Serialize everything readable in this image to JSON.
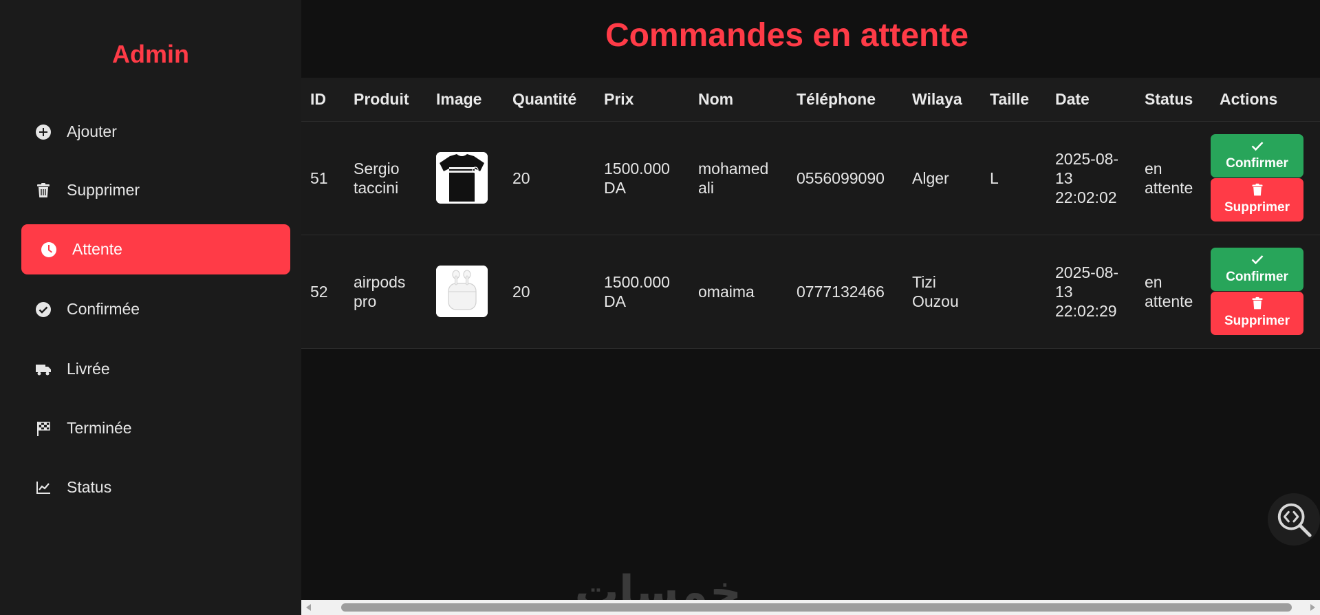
{
  "sidebar": {
    "brand": "Admin",
    "items": [
      {
        "label": "Ajouter",
        "icon": "plus-circle-icon"
      },
      {
        "label": "Supprimer",
        "icon": "trash-icon"
      },
      {
        "label": "Attente",
        "icon": "clock-icon",
        "active": true
      },
      {
        "label": "Confirmée",
        "icon": "check-circle-icon"
      },
      {
        "label": "Livrée",
        "icon": "truck-icon"
      },
      {
        "label": "Terminée",
        "icon": "checkered-flag-icon"
      },
      {
        "label": "Status",
        "icon": "line-chart-icon"
      }
    ]
  },
  "main": {
    "title": "Commandes en attente",
    "columns": [
      "ID",
      "Produit",
      "Image",
      "Quantité",
      "Prix",
      "Nom",
      "Téléphone",
      "Wilaya",
      "Taille",
      "Date",
      "Status",
      "Actions"
    ],
    "rows": [
      {
        "id": "51",
        "produit": "Sergio taccini",
        "image": "black t-shirt",
        "quantite": "20",
        "prix": "1500.000 DA",
        "nom": "mohamed ali",
        "telephone": "0556099090",
        "wilaya": "Alger",
        "taille": "L",
        "date": "2025-08-13 22:02:02",
        "status": "en attente",
        "confirm_label": "Confirmer",
        "delete_label": "Supprimer"
      },
      {
        "id": "52",
        "produit": "airpods pro",
        "image": "white airpods case",
        "quantite": "20",
        "prix": "1500.000 DA",
        "nom": "omaima",
        "telephone": "0777132466",
        "wilaya": "Tizi Ouzou",
        "taille": "",
        "date": "2025-08-13 22:02:29",
        "status": "en attente",
        "confirm_label": "Confirmer",
        "delete_label": "Supprimer"
      }
    ]
  },
  "watermark": "خمسات",
  "colors": {
    "accent": "#ff3b47",
    "confirm": "#28a55a",
    "sidebar_bg": "#1b1b1b",
    "main_bg": "#111111"
  }
}
